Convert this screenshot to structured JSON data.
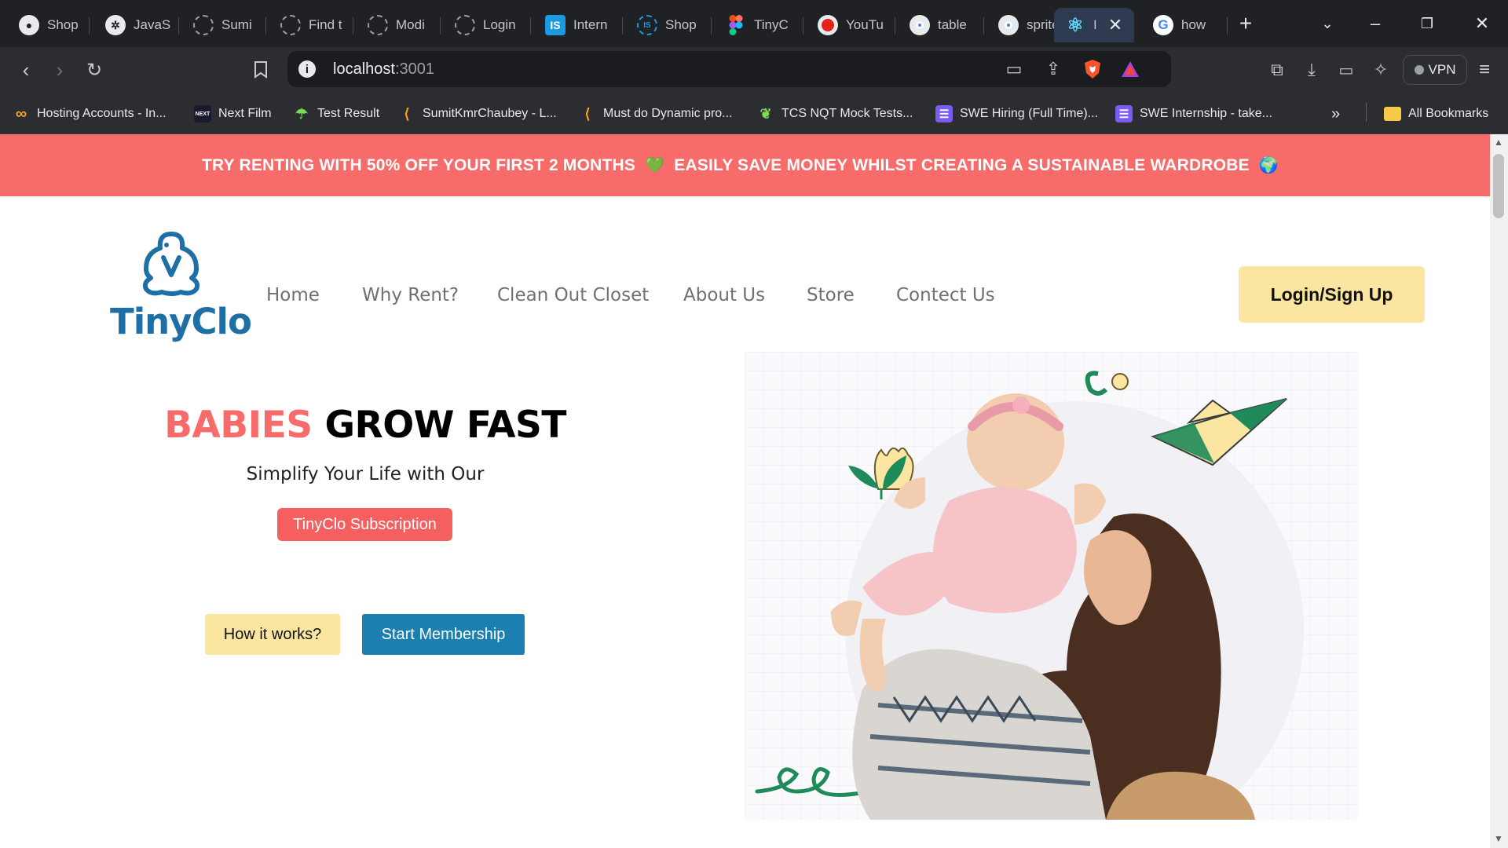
{
  "browser": {
    "tabs": [
      {
        "title": "Shop",
        "icon": "github-icon"
      },
      {
        "title": "JavaS",
        "icon": "openai-icon"
      },
      {
        "title": "Sumi",
        "icon": "loading-icon"
      },
      {
        "title": "Find t",
        "icon": "loading-icon"
      },
      {
        "title": "Modi",
        "icon": "loading-icon"
      },
      {
        "title": "Login",
        "icon": "loading-icon"
      },
      {
        "title": "Intern",
        "icon": "is-icon"
      },
      {
        "title": "Shop",
        "icon": "is-icon"
      },
      {
        "title": "TinyC",
        "icon": "figma-icon"
      },
      {
        "title": "YouTu",
        "icon": "youtube-icon"
      },
      {
        "title": "table",
        "icon": "chrome-icon"
      },
      {
        "title": "sprite",
        "icon": "chrome-icon"
      },
      {
        "title": "I",
        "icon": "react-icon",
        "active": true
      },
      {
        "title": "how",
        "icon": "google-icon"
      }
    ],
    "url_host": "localhost",
    "url_port": ":3001",
    "vpn_label": "VPN",
    "bookmarks": [
      {
        "label": "Hosting Accounts - In...",
        "icon": "infinity-icon"
      },
      {
        "label": "Next Film",
        "icon": "nextfilm-icon"
      },
      {
        "label": "Test Result",
        "icon": "mushroom-icon"
      },
      {
        "label": "SumitKmrChaubey - L...",
        "icon": "leetcode-icon"
      },
      {
        "label": "Must do Dynamic pro...",
        "icon": "leetcode-icon"
      },
      {
        "label": "TCS NQT Mock Tests...",
        "icon": "leaf-icon"
      },
      {
        "label": "SWE Hiring (Full Time)...",
        "icon": "list-icon"
      },
      {
        "label": "SWE Internship - take...",
        "icon": "list-icon"
      }
    ],
    "bookmarks_overflow": "»",
    "all_bookmarks": "All Bookmarks"
  },
  "promo": {
    "part1": "TRY RENTING WITH 50% OFF YOUR FIRST 2 MONTHS",
    "emoji1": "💚",
    "part2": "EASILY SAVE MONEY WHILST CREATING A SUSTAINABLE WARDROBE",
    "emoji2": "🌍"
  },
  "header": {
    "logo_text": "TinyClo",
    "nav": [
      "Home",
      "Why Rent?",
      "Clean Out Closet",
      "About Us",
      "Store",
      "Contect Us"
    ],
    "login_label": "Login/Sign Up"
  },
  "hero": {
    "title_accent": "BABIES",
    "title_rest": "GROW FAST",
    "subtitle": "Simplify Your Life with Our",
    "subscription_label": "TinyClo Subscription",
    "how_label": "How it works?",
    "start_label": "Start Membership"
  },
  "colors": {
    "promo": "#f76b6b",
    "brand_blue": "#1d6fa5",
    "accent_yellow": "#fbe6a1",
    "primary_blue": "#1b7fb0"
  }
}
